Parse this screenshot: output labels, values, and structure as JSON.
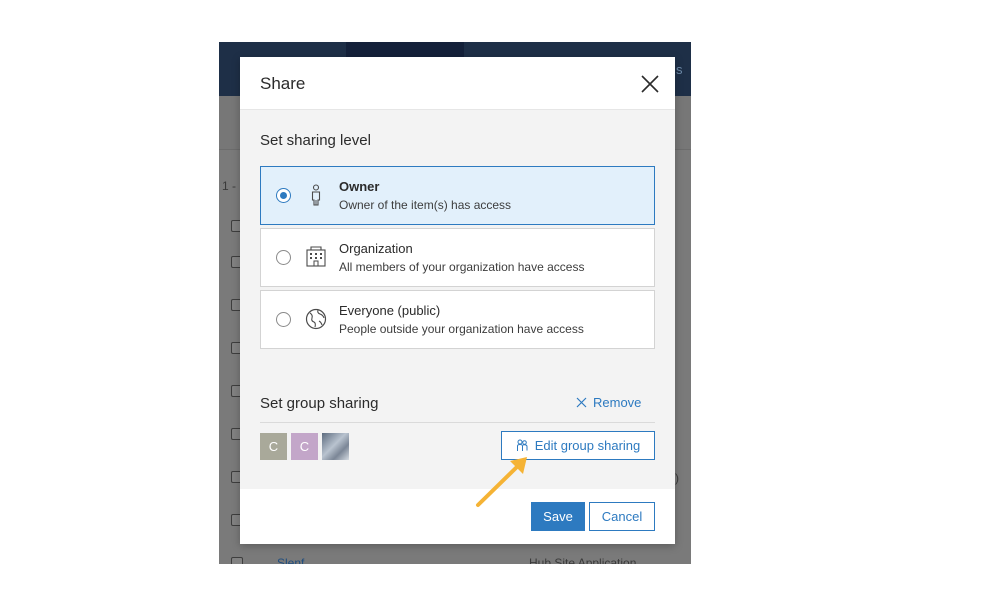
{
  "background": {
    "header_text": "s",
    "counter": "1 -",
    "rows": [
      {
        "name": "",
        "type": ""
      },
      {
        "name": "",
        "type": ""
      },
      {
        "name": "",
        "type": ""
      },
      {
        "name": "",
        "type": ""
      },
      {
        "name": "",
        "type": ""
      },
      {
        "name": "",
        "type": ""
      },
      {
        "name": "",
        "type": ")"
      },
      {
        "name": "",
        "type": ""
      },
      {
        "name": "Slenf",
        "type": "Hub Site Application"
      }
    ]
  },
  "dialog": {
    "title": "Share",
    "close_icon": "close-icon",
    "sharing_level": {
      "heading": "Set sharing level",
      "options": [
        {
          "label": "Owner",
          "description": "Owner of the item(s) has access",
          "icon": "person-icon",
          "selected": true
        },
        {
          "label": "Organization",
          "description": "All members of your organization have access",
          "icon": "building-icon",
          "selected": false
        },
        {
          "label": "Everyone (public)",
          "description": "People outside your organization have access",
          "icon": "globe-icon",
          "selected": false
        }
      ]
    },
    "group_sharing": {
      "heading": "Set group sharing",
      "remove_label": "Remove",
      "groups": [
        {
          "initial": "C",
          "color": "#a9a99a"
        },
        {
          "initial": "C",
          "color": "#c3a6c9"
        },
        {
          "initial": "",
          "color": "#8c97a8"
        }
      ],
      "edit_label": "Edit group sharing"
    },
    "footer": {
      "save_label": "Save",
      "cancel_label": "Cancel"
    }
  },
  "colors": {
    "accent": "#2d7ac0",
    "selected_bg": "#e2f0fb",
    "annotation_arrow": "#f5b335"
  }
}
